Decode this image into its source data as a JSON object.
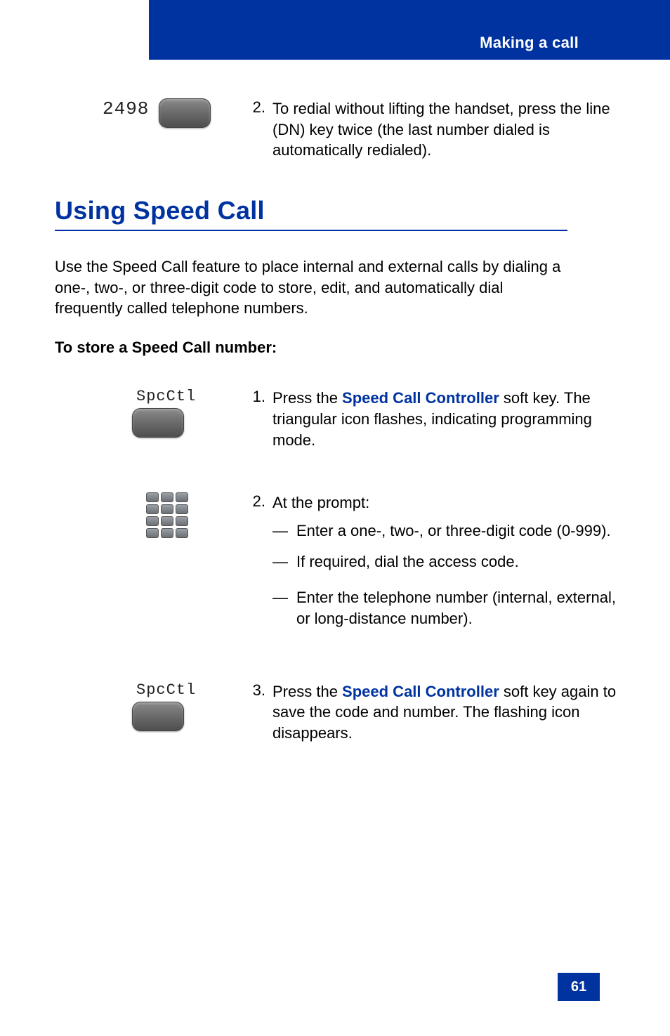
{
  "header": {
    "chapter": "Making a call"
  },
  "redial_step": {
    "lcd": "2498",
    "num": "2.",
    "text": "To redial without lifting the handset, press the line (DN) key twice (the last number dialed is automatically redialed)."
  },
  "section": {
    "heading": "Using Speed Call",
    "intro": "Use the Speed Call feature to place internal and external calls by dialing a one-, two-, or three-digit code to store, edit, and automatically dial frequently called telephone numbers.",
    "sub_heading": "To store a Speed Call number:"
  },
  "steps": [
    {
      "lcd": "SpcCtl",
      "num": "1.",
      "pre": "Press the ",
      "key": "Speed Call Controller",
      "post": " soft key. The triangular icon flashes, indicating programming mode."
    },
    {
      "num": "2.",
      "text": "At the prompt:",
      "sub": [
        "Enter a one-, two-, or three-digit code (0-999).",
        "If required, dial the access code.",
        "Enter the telephone number (internal, external, or long-distance number)."
      ]
    },
    {
      "lcd": "SpcCtl",
      "num": "3.",
      "pre": "Press the ",
      "key": "Speed Call Controller",
      "post": " soft key again to save the code and number. The flashing icon disappears."
    }
  ],
  "page_number": "61"
}
